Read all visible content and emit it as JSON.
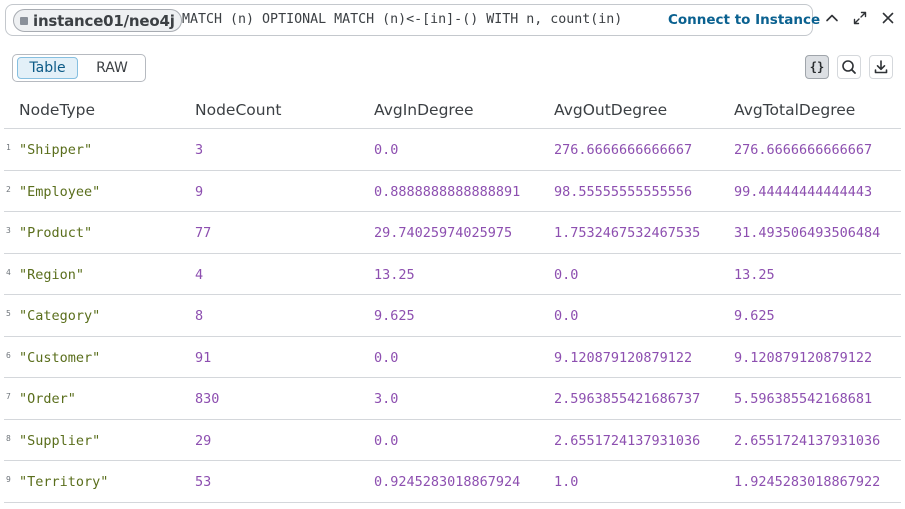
{
  "header": {
    "instance": "instance01/neo4j",
    "query": "MATCH (n) OPTIONAL MATCH (n)<-[in]-() WITH n, count(in)",
    "connect_label": "Connect to Instance",
    "icons": [
      "collapse-icon",
      "expand-icon",
      "close-icon"
    ]
  },
  "view_toggle": {
    "table_label": "Table",
    "raw_label": "RAW",
    "selected": "Table"
  },
  "toolbar": {
    "json_label": "{}",
    "icons": [
      "json-icon",
      "search-icon",
      "download-icon"
    ]
  },
  "table": {
    "columns": [
      "NodeType",
      "NodeCount",
      "AvgInDegree",
      "AvgOutDegree",
      "AvgTotalDegree"
    ],
    "rows": [
      {
        "n": "1",
        "cells": [
          "\"Shipper\"",
          "3",
          "0.0",
          "276.6666666666667",
          "276.6666666666667"
        ]
      },
      {
        "n": "2",
        "cells": [
          "\"Employee\"",
          "9",
          "0.8888888888888891",
          "98.55555555555556",
          "99.44444444444443"
        ]
      },
      {
        "n": "3",
        "cells": [
          "\"Product\"",
          "77",
          "29.74025974025975",
          "1.7532467532467535",
          "31.493506493506484"
        ]
      },
      {
        "n": "4",
        "cells": [
          "\"Region\"",
          "4",
          "13.25",
          "0.0",
          "13.25"
        ]
      },
      {
        "n": "5",
        "cells": [
          "\"Category\"",
          "8",
          "9.625",
          "0.0",
          "9.625"
        ]
      },
      {
        "n": "6",
        "cells": [
          "\"Customer\"",
          "91",
          "0.0",
          "9.120879120879122",
          "9.120879120879122"
        ]
      },
      {
        "n": "7",
        "cells": [
          "\"Order\"",
          "830",
          "3.0",
          "2.5963855421686737",
          "5.596385542168681"
        ]
      },
      {
        "n": "8",
        "cells": [
          "\"Supplier\"",
          "29",
          "0.0",
          "2.6551724137931036",
          "2.6551724137931036"
        ]
      },
      {
        "n": "9",
        "cells": [
          "\"Territory\"",
          "53",
          "0.9245283018867924",
          "1.0",
          "1.9245283018867922"
        ]
      }
    ]
  },
  "colors": {
    "string_value": "#5a6e1c",
    "number_value": "#8d4fb0",
    "accent": "#0a6190"
  }
}
